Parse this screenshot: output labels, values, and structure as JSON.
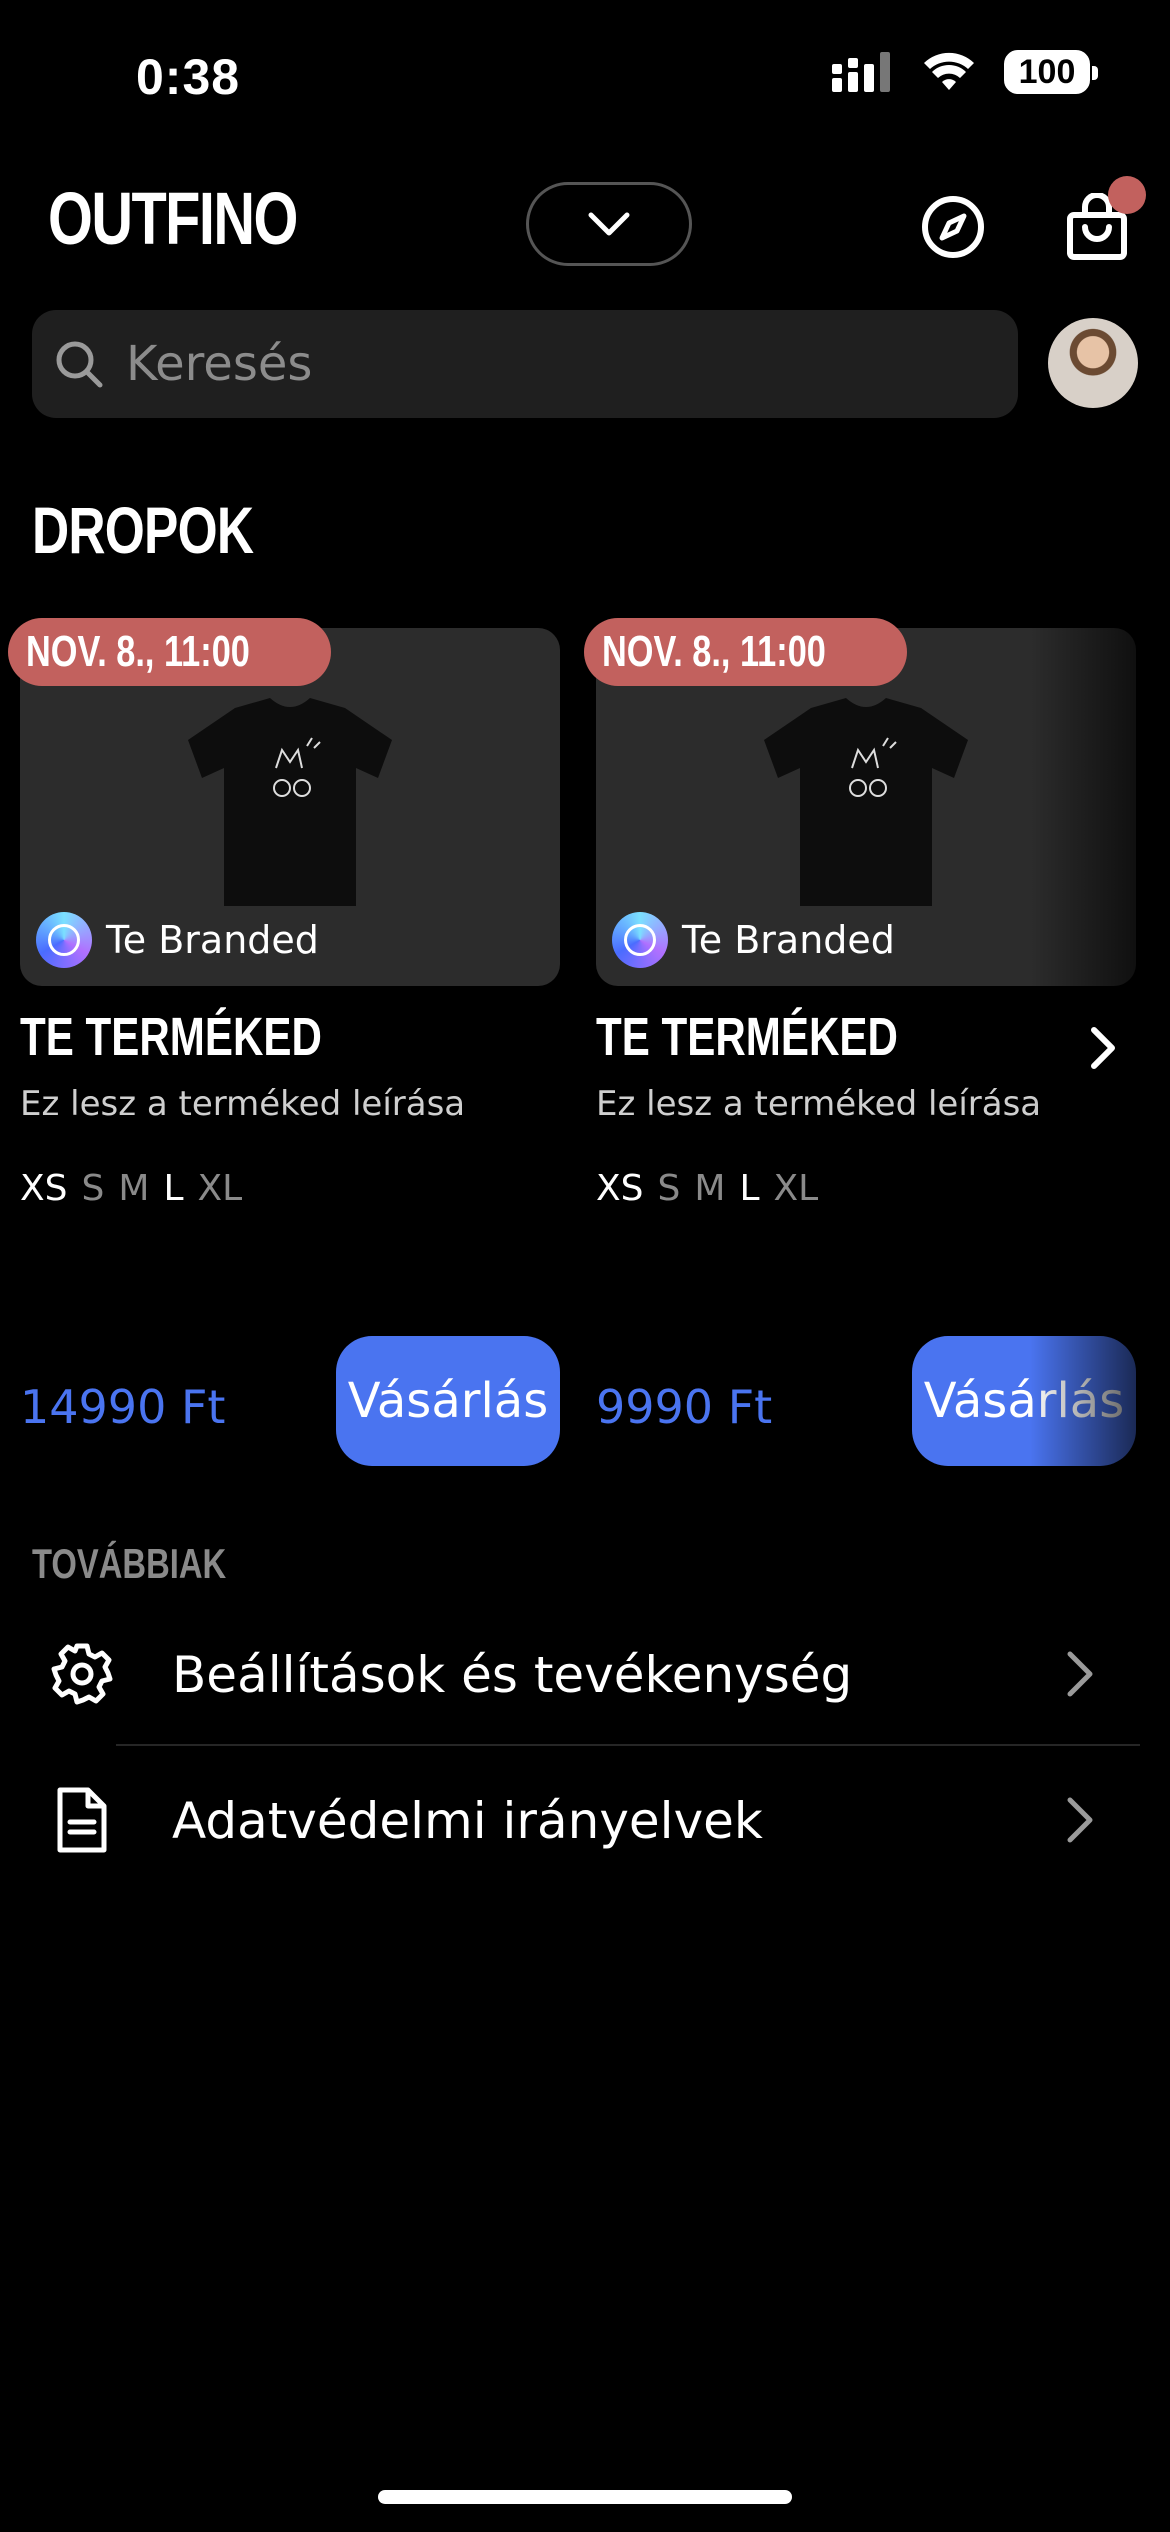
{
  "status": {
    "time": "0:38",
    "battery": "100"
  },
  "header": {
    "logo": "OUTFINO"
  },
  "search": {
    "placeholder": "Keresés"
  },
  "section": {
    "title": "DROPOK"
  },
  "products": [
    {
      "date": "NOV. 8., 11:00",
      "brand": "Te Branded",
      "title": "TE TERMÉKED",
      "description": "Ez lesz a terméked leírása",
      "sizes": [
        "XS",
        "S",
        "M",
        "L",
        "XL"
      ],
      "price": "14990 Ft",
      "buy_label": "Vásárlás"
    },
    {
      "date": "NOV. 8., 11:00",
      "brand": "Te Branded",
      "title": "TE TERMÉKED",
      "description": "Ez lesz a terméked leírása",
      "sizes": [
        "XS",
        "S",
        "M",
        "L",
        "XL"
      ],
      "price": "9990 Ft",
      "buy_label": "Vásárlás"
    }
  ],
  "more": {
    "title": "TOVÁBBIAK",
    "items": [
      {
        "label": "Beállítások és tevékenység",
        "icon": "gear-icon"
      },
      {
        "label": "Adatvédelmi irányelvek",
        "icon": "document-icon"
      }
    ]
  },
  "colors": {
    "accent": "#4a74f0",
    "badge": "#c2615e",
    "card_bg": "#2c2c2c"
  }
}
